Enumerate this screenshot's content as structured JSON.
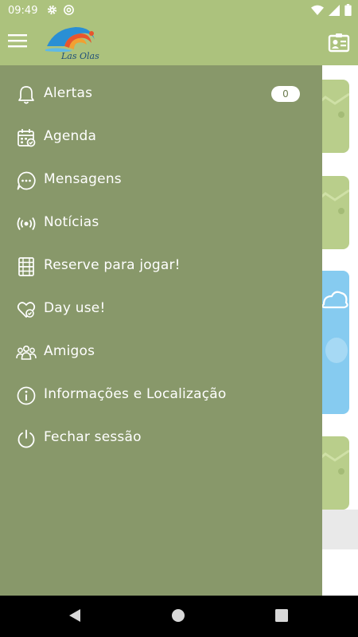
{
  "status_bar": {
    "time": "09:49",
    "left_icons": [
      "gear-icon",
      "at-sign-icon"
    ],
    "right_icons": [
      "wifi-icon",
      "signal-icon",
      "battery-icon"
    ]
  },
  "app_bar": {
    "logo_text": "Las Olas",
    "menu_icon": "hamburger-icon",
    "action_icon": "contact-card-icon"
  },
  "drawer": {
    "items": [
      {
        "label": "Alertas",
        "icon": "bell-icon",
        "badge": "0"
      },
      {
        "label": "Agenda",
        "icon": "calendar-icon"
      },
      {
        "label": "Mensagens",
        "icon": "chat-bubble-icon"
      },
      {
        "label": "Notícias",
        "icon": "broadcast-icon"
      },
      {
        "label": "Reserve para jogar!",
        "icon": "court-icon"
      },
      {
        "label": "Day use!",
        "icon": "heart-check-icon"
      },
      {
        "label": "Amigos",
        "icon": "people-icon"
      },
      {
        "label": "Informações e Localização",
        "icon": "info-icon"
      },
      {
        "label": "Fechar sessão",
        "icon": "power-icon"
      }
    ]
  },
  "nav_bar": {
    "buttons": [
      "back-icon",
      "home-icon",
      "recents-icon"
    ]
  },
  "colors": {
    "app_bar": "#acc27d",
    "drawer": "#88986a",
    "card_green": "#b9ce8b",
    "card_blue": "#86cbf0"
  }
}
